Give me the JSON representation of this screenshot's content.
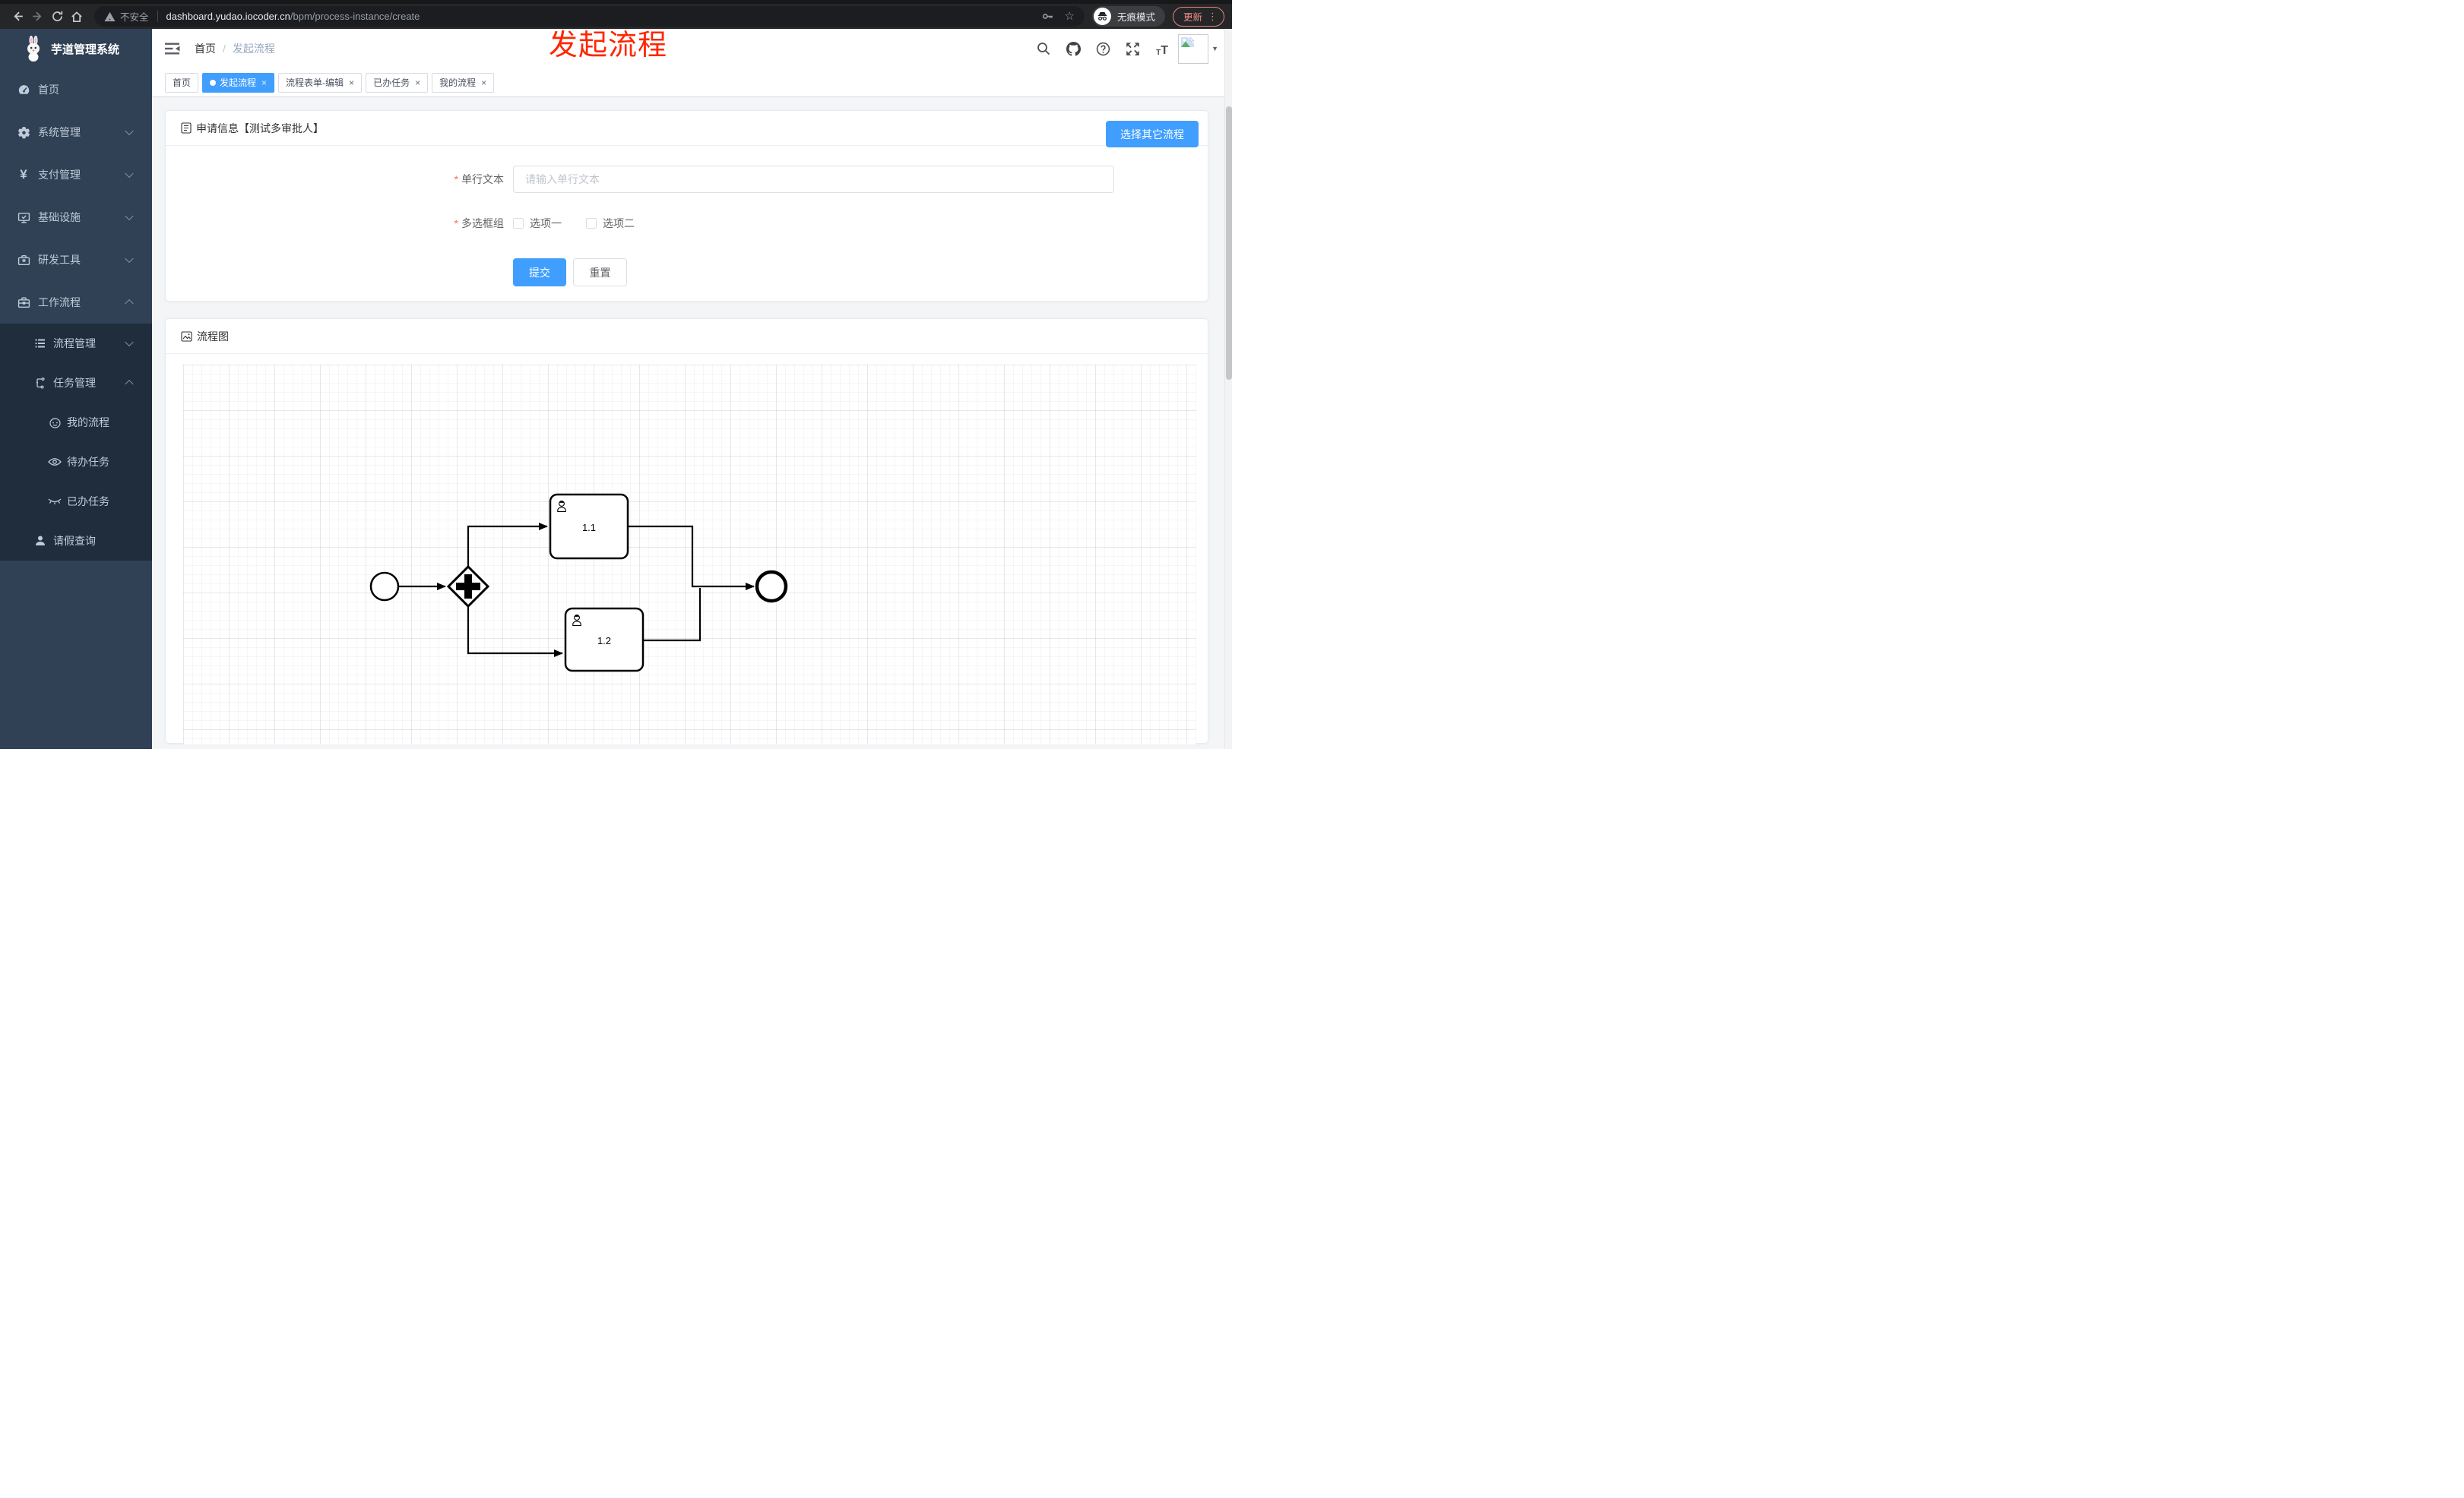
{
  "browser": {
    "security_label": "不安全",
    "url_host": "dashboard.yudao.iocoder.cn",
    "url_path": "/bpm/process-instance/create",
    "incognito_label": "无痕模式",
    "update_label": "更新"
  },
  "annotation": {
    "text": "发起流程",
    "color": "#ff2600"
  },
  "sidebar": {
    "logo_title": "芋道管理系统",
    "items": [
      {
        "label": "首页"
      },
      {
        "label": "系统管理"
      },
      {
        "label": "支付管理"
      },
      {
        "label": "基础设施"
      },
      {
        "label": "研发工具"
      },
      {
        "label": "工作流程"
      },
      {
        "label": "流程管理"
      },
      {
        "label": "任务管理"
      },
      {
        "label": "我的流程"
      },
      {
        "label": "待办任务"
      },
      {
        "label": "已办任务"
      },
      {
        "label": "请假查询"
      }
    ]
  },
  "header": {
    "breadcrumb": [
      "首页",
      "发起流程"
    ]
  },
  "tabs": [
    {
      "label": "首页"
    },
    {
      "label": "发起流程"
    },
    {
      "label": "流程表单-编辑"
    },
    {
      "label": "已办任务"
    },
    {
      "label": "我的流程"
    }
  ],
  "form_card": {
    "title": "申请信息【测试多审批人】",
    "choose_button": "选择其它流程",
    "field_text": {
      "label": "单行文本",
      "placeholder": "请输入单行文本",
      "value": ""
    },
    "field_checkbox": {
      "label": "多选框组",
      "options": [
        "选项一",
        "选项二"
      ]
    },
    "submit_label": "提交",
    "reset_label": "重置"
  },
  "flow_card": {
    "title": "流程图",
    "tasks": [
      "1.1",
      "1.2"
    ]
  },
  "ui": {
    "close": "×",
    "sep": "/",
    "star": "☆",
    "caret": "▼",
    "dots": "⋮",
    "yen": "¥",
    "t_small": "T",
    "t_large": "T"
  },
  "colors": {
    "accent": "#409eff",
    "sidebar": "#304156",
    "submenu": "#1f2d3d",
    "annotation": "#ff2600",
    "required": "#f56c6c"
  }
}
